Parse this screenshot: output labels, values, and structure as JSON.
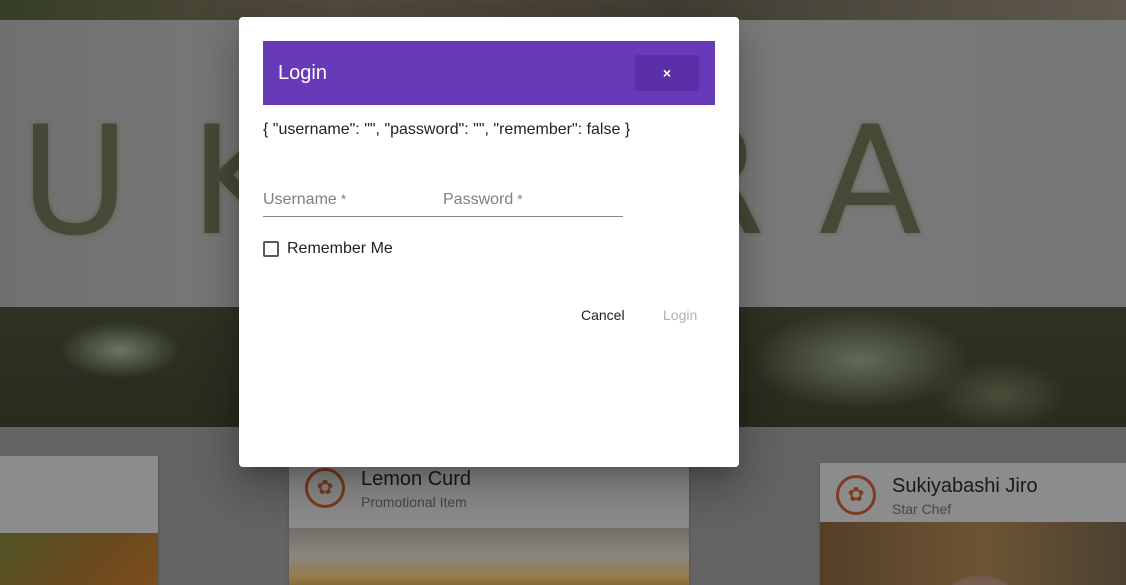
{
  "background": {
    "hero_letters": "UKIJIRA",
    "cards": [
      {
        "title": "",
        "subtitle": ""
      },
      {
        "title": "Lemon Curd",
        "subtitle": "Promotional Item"
      },
      {
        "title": "Sukiyabashi Jiro",
        "subtitle": "Star Chef"
      }
    ]
  },
  "dialog": {
    "title": "Login",
    "close_label": "×",
    "state_json": "{ \"username\": \"\", \"password\": \"\", \"remember\": false }",
    "username": {
      "label": "Username",
      "required_mark": "*",
      "value": ""
    },
    "password": {
      "label": "Password",
      "required_mark": "*",
      "value": ""
    },
    "remember": {
      "label": "Remember Me",
      "checked": false
    },
    "cancel_label": "Cancel",
    "login_label": "Login"
  },
  "colors": {
    "header": "#673ab7",
    "avatar_accent": "#b5562d",
    "disabled_text": "#b0b0b0"
  },
  "icons": {
    "card_avatar": "flower-logo-icon",
    "close": "close-icon"
  }
}
